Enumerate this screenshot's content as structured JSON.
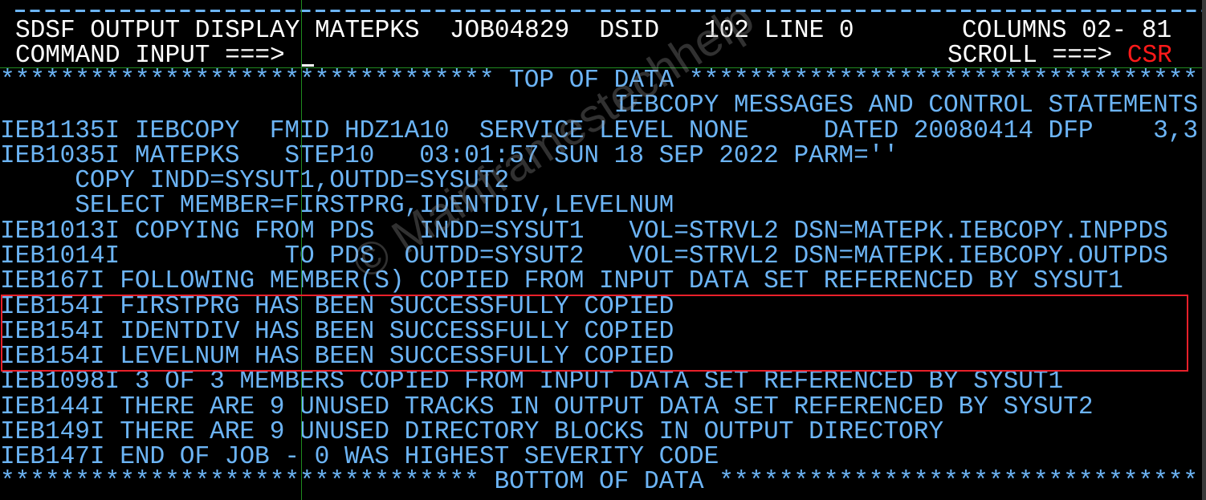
{
  "header": {
    "dash_line": "--------------------------------------------------------------------------------",
    "title": "SDSF OUTPUT DISPLAY",
    "jobname": "MATEPKS",
    "jobid": "JOB04829",
    "dsid_label": "DSID",
    "dsid_value": "102",
    "line_label": "LINE",
    "line_value": "0",
    "columns_label": "COLUMNS",
    "columns_value": "02- 81",
    "command_label": "COMMAND INPUT ===>",
    "command_value": "",
    "scroll_label": "SCROLL ===>",
    "scroll_value": "CSR"
  },
  "colors": {
    "background": "#000000",
    "header_text": "#ffffff",
    "output_text": "#6cb4f5",
    "scroll_value": "#ff1a1a",
    "highlight_box": "#e8202a",
    "grid_line": "#1f8a1f"
  },
  "output": {
    "top_marker": "********************************* TOP OF DATA **********************************",
    "lines": [
      "                                         IEBCOPY MESSAGES AND CONTROL STATEMENTS",
      "IEB1135I IEBCOPY  FMID HDZ1A10  SERVICE LEVEL NONE     DATED 20080414 DFP    3,3",
      "IEB1035I MATEPKS   STEP10   03:01:57 SUN 18 SEP 2022 PARM=''",
      "     COPY INDD=SYSUT1,OUTDD=SYSUT2",
      "     SELECT MEMBER=FIRSTPRG,IDENTDIV,LEVELNUM",
      "IEB1013I COPYING FROM PDS   INDD=SYSUT1   VOL=STRVL2 DSN=MATEPK.IEBCOPY.INPPDS",
      "IEB1014I           TO PDS  OUTDD=SYSUT2   VOL=STRVL2 DSN=MATEPK.IEBCOPY.OUTPDS",
      "IEB167I FOLLOWING MEMBER(S) COPIED FROM INPUT DATA SET REFERENCED BY SYSUT1",
      "IEB154I FIRSTPRG HAS BEEN SUCCESSFULLY COPIED",
      "IEB154I IDENTDIV HAS BEEN SUCCESSFULLY COPIED",
      "IEB154I LEVELNUM HAS BEEN SUCCESSFULLY COPIED",
      "IEB1098I 3 OF 3 MEMBERS COPIED FROM INPUT DATA SET REFERENCED BY SYSUT1",
      "IEB144I THERE ARE 9 UNUSED TRACKS IN OUTPUT DATA SET REFERENCED BY SYSUT2",
      "IEB149I THERE ARE 9 UNUSED DIRECTORY BLOCKS IN OUTPUT DIRECTORY",
      "IEB147I END OF JOB - 0 WAS HIGHEST SEVERITY CODE"
    ],
    "bottom_marker": "******************************** BOTTOM OF DATA ********************************"
  },
  "watermark": "© Mainframestechhelp"
}
